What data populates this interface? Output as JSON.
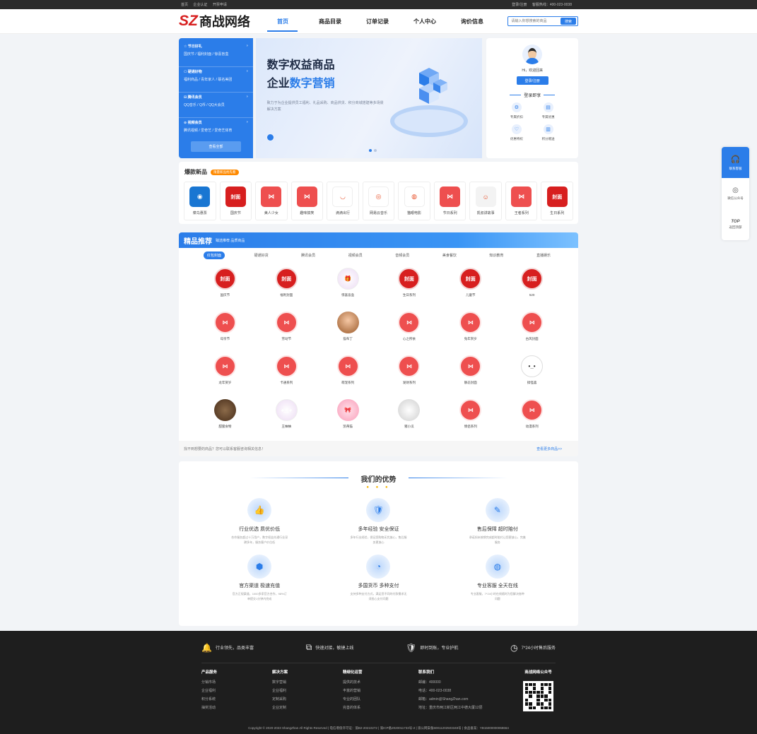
{
  "topbar": {
    "left": [
      "首页",
      "企业认证",
      "开票申请"
    ],
    "right_login": "登录/注册",
    "right_phone": "客服热线：400-023-0038"
  },
  "header": {
    "logo_mark": "SZ",
    "logo_text": "商战网络",
    "nav": [
      "首页",
      "商品目录",
      "订单记录",
      "个人中心",
      "询价信息"
    ],
    "search_placeholder": "请输入你想搜索的商品",
    "search_button": "搜索"
  },
  "categories": [
    {
      "title": "节日好礼",
      "sub": "国庆节 / 福利封面 / 惊喜盲盒"
    },
    {
      "title": "硬通好物",
      "sub": "福利商品 / 青年家人 / 联名美团"
    },
    {
      "title": "腾讯会员",
      "sub": "QQ音乐 / Q币 / QQ大会员"
    },
    {
      "title": "视频会员",
      "sub": "腾讯视频 / 爱奇艺 / 爱奇艺体育"
    }
  ],
  "categories_view_all": "查看全部",
  "banner": {
    "line1": "数字权益商品",
    "line2_a": "企业",
    "line2_b": "数字营销",
    "desc": "致力于为企业提供员工福利、礼品采购、商品供货、积分商城搭建等多场景解决方案"
  },
  "user": {
    "greeting": "Hi，欢迎回来",
    "login_button": "登录/注册",
    "perks_title": "登录即享",
    "perks": [
      {
        "icon": "⚙",
        "label": "专属折扣"
      },
      {
        "icon": "▤",
        "label": "专属优惠"
      },
      {
        "icon": "♡",
        "label": "优惠特权"
      },
      {
        "icon": "▥",
        "label": "积分赠送"
      }
    ]
  },
  "hot": {
    "title": "爆款新品",
    "tag": "限量新品抢先看",
    "items": [
      {
        "label": "菜鸟惠票",
        "style": "hb-cai",
        "glyph": "◉"
      },
      {
        "label": "国庆节",
        "style": "hb-feng",
        "glyph": "封面"
      },
      {
        "label": "美人少女",
        "style": "hb-red",
        "glyph": "⋈"
      },
      {
        "label": "趣味搞笑",
        "style": "hb-red",
        "glyph": "⋈"
      },
      {
        "label": "滴滴出行",
        "style": "hb-white",
        "glyph": "◡"
      },
      {
        "label": "网易云音乐",
        "style": "hb-white",
        "glyph": "◎"
      },
      {
        "label": "猫眼电影",
        "style": "hb-white",
        "glyph": "◍"
      },
      {
        "label": "节日系列",
        "style": "hb-red",
        "glyph": "⋈"
      },
      {
        "label": "凯叔讲故事",
        "style": "hb-gray",
        "glyph": "☺"
      },
      {
        "label": "王者系列",
        "style": "hb-red",
        "glyph": "⋈"
      },
      {
        "label": "生日系列",
        "style": "hb-feng",
        "glyph": "封面"
      }
    ]
  },
  "recommend": {
    "title": "精品推荐",
    "subtitle": "臻选推荐 品质商品",
    "tabs": [
      "红包封面",
      "硬通好货",
      "腾讯会员",
      "视频会员",
      "音频会员",
      "美食餐饮",
      "知识教育",
      "直播娱乐"
    ],
    "items": [
      {
        "label": "国庆节",
        "style": "feng",
        "glyph": "封面"
      },
      {
        "label": "福利封面",
        "style": "feng",
        "glyph": "封面"
      },
      {
        "label": "惊喜盲盒",
        "style": "cute",
        "glyph": "🎁"
      },
      {
        "label": "生日系列",
        "style": "feng",
        "glyph": "封面"
      },
      {
        "label": "儿童节",
        "style": "feng",
        "glyph": "封面"
      },
      {
        "label": "520",
        "style": "feng",
        "glyph": "封面"
      },
      {
        "label": "母亲节",
        "style": "ribbon",
        "glyph": "⋈"
      },
      {
        "label": "劳动节",
        "style": "ribbon",
        "glyph": "⋈"
      },
      {
        "label": "猫布丁",
        "style": "photo",
        "glyph": ""
      },
      {
        "label": "心之所依",
        "style": "ribbon",
        "glyph": "⋈"
      },
      {
        "label": "兔年贺岁",
        "style": "ribbon",
        "glyph": "⋈"
      },
      {
        "label": "古风封面",
        "style": "ribbon",
        "glyph": "⋈"
      },
      {
        "label": "龙年贺岁",
        "style": "ribbon",
        "glyph": "⋈"
      },
      {
        "label": "卡通系列",
        "style": "ribbon",
        "glyph": "⋈"
      },
      {
        "label": "萌宠系列",
        "style": "ribbon",
        "glyph": "⋈"
      },
      {
        "label": "发财系列",
        "style": "ribbon",
        "glyph": "⋈"
      },
      {
        "label": "静态封面",
        "style": "ribbon",
        "glyph": "⋈"
      },
      {
        "label": "搞怪喜",
        "style": "face",
        "glyph": "•_•"
      },
      {
        "label": "甜蜜食物",
        "style": "dark",
        "glyph": ""
      },
      {
        "label": "王柚柚",
        "style": "cute",
        "glyph": "◕‿◕"
      },
      {
        "label": "凯蒂猫",
        "style": "pink",
        "glyph": "🎀"
      },
      {
        "label": "猪小瓜",
        "style": "pig",
        "glyph": ""
      },
      {
        "label": "情侣系列",
        "style": "ribbon",
        "glyph": "⋈"
      },
      {
        "label": "动漫系列",
        "style": "ribbon",
        "glyph": "⋈"
      }
    ],
    "foot_text": "找不到想要的商品？您可以联系客服咨询相关信息！",
    "foot_more": "查看更多商品>>"
  },
  "advantages": {
    "title": "我们的优势",
    "items": [
      {
        "icon": "👍",
        "title": "行业优选 质优价低",
        "desc": "合作服务超过十万用户，数字权益先通行业深耕多年，服务客户价位低"
      },
      {
        "icon": "🛡",
        "title": "多年经验 安全保证",
        "desc": "多年行业经验，保证您购物无忧放心，售后服务更放心"
      },
      {
        "icon": "✎",
        "title": "售后保障 超时赔付",
        "desc": "承诺如未按期完成超时赔付让您更放心，完美服务"
      },
      {
        "icon": "⬢",
        "title": "官方渠道 极速充值",
        "desc": "官方正规渠道，1000多家官方合作，98%订单提交1分钟内完成"
      },
      {
        "icon": "◔",
        "title": "多国货币 多种支付",
        "desc": "支持多种支付方式，满足您不同的付款需求无须担心支付问题"
      },
      {
        "icon": "◍",
        "title": "专业客服 全天在线",
        "desc": "专业客服，7*24小时在线随时为您解决各种问题"
      }
    ]
  },
  "footer": {
    "features": [
      {
        "icon": "🔔",
        "text": "行业领先，品类丰富"
      },
      {
        "icon": "⧉",
        "text": "快速对接，敏捷上线"
      },
      {
        "icon": "🛡",
        "text": "即时到账，专业护航"
      },
      {
        "icon": "◷",
        "text": "7*24小时售后服务"
      }
    ],
    "columns": [
      {
        "title": "产品服务",
        "links": [
          "分销市场",
          "企业福利",
          "积分系统",
          "抽奖活动"
        ]
      },
      {
        "title": "解决方案",
        "links": [
          "数字营销",
          "企业福利",
          "定制采购",
          "企业定制"
        ]
      },
      {
        "title": "精细化运营",
        "links": [
          "提供的技术",
          "丰富的营销",
          "专业的团队",
          "完善的体系"
        ]
      },
      {
        "title": "联系我们",
        "links": [
          "邮编：400000",
          "电话：400-023-0038",
          "邮箱：admin@ShangZhan.com",
          "地址：重庆市两江新区两江中德大厦12层"
        ]
      }
    ],
    "qr_title": "商战网络公众号",
    "copyright": "Copyright © 2020-2023 ShangZhan All Rights Reserved | 电信增值许可证：渝B2-20210272 | 渝ICP备2020011733号-2 | 渝公网安备50011202503348号 | 食品备案：YB15000000068664"
  },
  "side": {
    "service": "联系客服",
    "wechat": "微信公众号",
    "top": "TOP",
    "back_top": "返回顶部"
  }
}
